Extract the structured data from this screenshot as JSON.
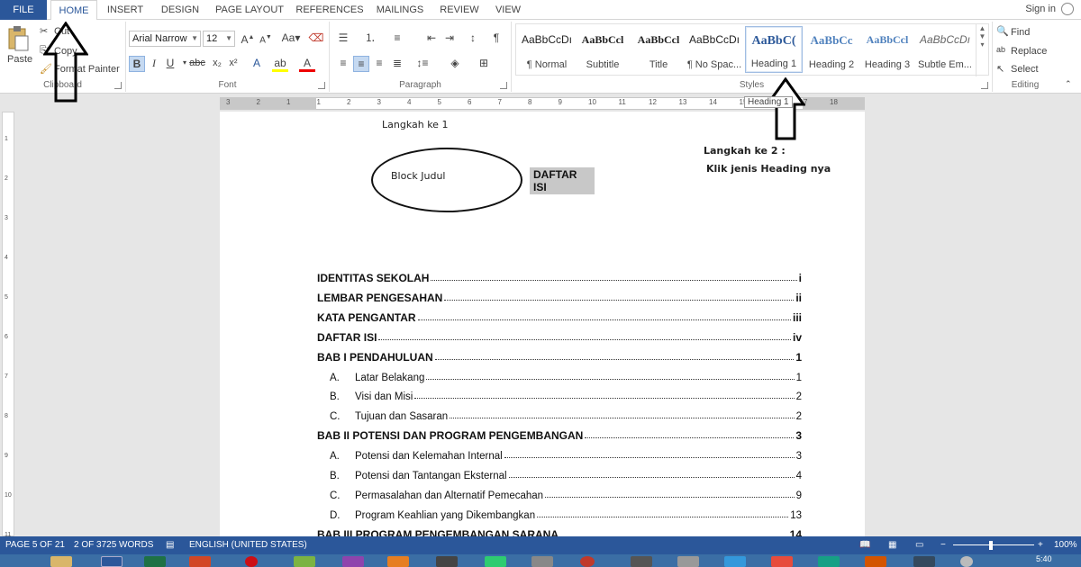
{
  "tabs": [
    {
      "label": "FILE"
    },
    {
      "label": "HOME"
    },
    {
      "label": "INSERT"
    },
    {
      "label": "DESIGN"
    },
    {
      "label": "PAGE LAYOUT"
    },
    {
      "label": "REFERENCES"
    },
    {
      "label": "MAILINGS"
    },
    {
      "label": "REVIEW"
    },
    {
      "label": "VIEW"
    }
  ],
  "account": {
    "signin": "Sign in"
  },
  "clipboard": {
    "paste": "Paste",
    "cut": "Cut",
    "copy": "Copy",
    "format_painter": "Format Painter",
    "label": "Clipboard"
  },
  "font": {
    "name": "Arial Narrow",
    "size": "12",
    "label": "Font"
  },
  "paragraph": {
    "label": "Paragraph"
  },
  "styles": {
    "label": "Styles",
    "items": [
      {
        "preview": "AaBbCcDı",
        "name": "¶ Normal"
      },
      {
        "preview": "AaBbCcl",
        "name": "Subtitle"
      },
      {
        "preview": "AaBbCcl",
        "name": "Title"
      },
      {
        "preview": "AaBbCcDı",
        "name": "¶ No Spac..."
      },
      {
        "preview": "AaBbC(",
        "name": "Heading 1"
      },
      {
        "preview": "AaBbCc",
        "name": "Heading 2"
      },
      {
        "preview": "AaBbCcl",
        "name": "Heading 3"
      },
      {
        "preview": "AaBbCcDı",
        "name": "Subtle Em..."
      }
    ],
    "tooltip": "Heading 1"
  },
  "editing": {
    "find": "Find",
    "replace": "Replace",
    "select": "Select",
    "label": "Editing"
  },
  "ruler_numbers": [
    "3",
    "2",
    "1",
    "1",
    "2",
    "3",
    "4",
    "5",
    "6",
    "7",
    "8",
    "9",
    "10",
    "11",
    "12",
    "13",
    "14",
    "15",
    "16",
    "17",
    "18"
  ],
  "vruler_numbers": [
    "1",
    "2",
    "3",
    "4",
    "5",
    "6",
    "7",
    "8",
    "9",
    "10",
    "11"
  ],
  "document": {
    "step1": "Langkah ke 1",
    "step2": "Langkah ke 2 :",
    "step2b": "Klik jenis Heading nya",
    "block_label": "Block Judul",
    "heading": "DAFTAR ISI",
    "toc": [
      {
        "text": "IDENTITAS SEKOLAH",
        "page": "i",
        "level": 1
      },
      {
        "text": "LEMBAR PENGESAHAN",
        "page": "ii",
        "level": 1
      },
      {
        "text": "KATA PENGANTAR",
        "page": "iii",
        "level": 1
      },
      {
        "text": "DAFTAR ISI",
        "page": "iv",
        "level": 1
      },
      {
        "text": "BAB I PENDAHULUAN",
        "page": "1",
        "level": 1
      },
      {
        "letter": "A.",
        "text": "Latar Belakang",
        "page": "1",
        "level": 2
      },
      {
        "letter": "B.",
        "text": "Visi dan Misi",
        "page": "2",
        "level": 2
      },
      {
        "letter": "C.",
        "text": "Tujuan dan Sasaran",
        "page": "2",
        "level": 2
      },
      {
        "text": "BAB II POTENSI DAN PROGRAM PENGEMBANGAN",
        "page": "3",
        "level": 1
      },
      {
        "letter": "A.",
        "text": "Potensi dan Kelemahan Internal",
        "page": "3",
        "level": 2
      },
      {
        "letter": "B.",
        "text": "Potensi dan Tantangan Eksternal",
        "page": "4",
        "level": 2
      },
      {
        "letter": "C.",
        "text": "Permasalahan dan Alternatif Pemecahan",
        "page": "9",
        "level": 2
      },
      {
        "letter": "D.",
        "text": "Program Keahlian yang Dikembangkan",
        "page": "13",
        "level": 2
      },
      {
        "text": "BAB III PROGRAM PENGEMBANGAN SARANA",
        "page": "14",
        "level": 1
      }
    ]
  },
  "status": {
    "page": "PAGE 5 OF 21",
    "words": "2 OF 3725 WORDS",
    "language": "ENGLISH (UNITED STATES)",
    "zoom": "100%",
    "zoom_level": 1.0
  },
  "taskbar": {
    "clock": "5:40"
  },
  "colors": {
    "accent": "#2b579a",
    "taskbar": "#3b6ea5"
  }
}
